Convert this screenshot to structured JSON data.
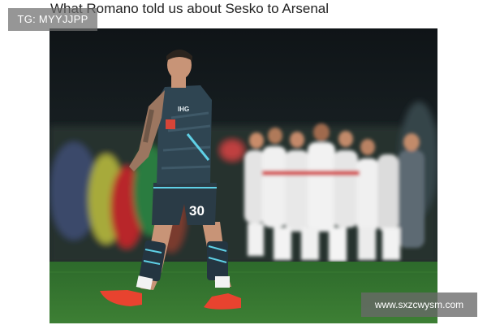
{
  "article": {
    "headline": "What Romano told us about Sesko to Arsenal"
  },
  "photo": {
    "player_shirt_number": "30"
  },
  "watermarks": {
    "top_left": "TG: MYYJJPP",
    "bottom_right": "www.sxzcwysm.com"
  },
  "colors": {
    "kit": "#2c3f4a",
    "kit_accent": "#5fd0e6",
    "pitch": "#2f6b2c",
    "boots": "#e8432f"
  }
}
